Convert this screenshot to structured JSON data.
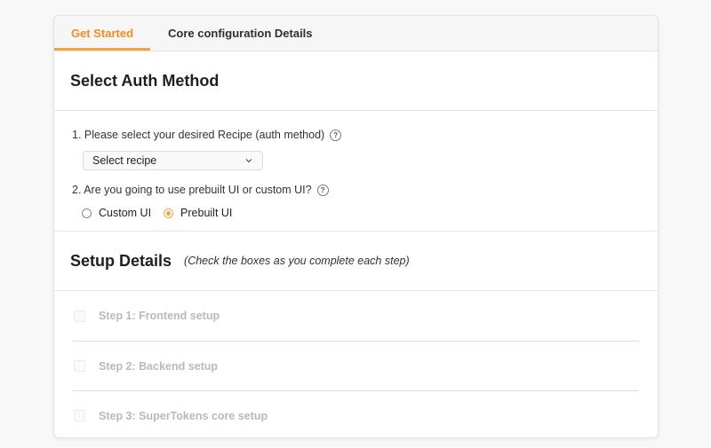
{
  "tabs": [
    {
      "label": "Get Started",
      "active": true
    },
    {
      "label": "Core configuration Details",
      "active": false
    }
  ],
  "auth": {
    "title": "Select Auth Method",
    "q1": "1. Please select your desired Recipe (auth method)",
    "select_value": "Select recipe",
    "q2": "2. Are you going to use prebuilt UI or custom UI?",
    "options": [
      {
        "label": "Custom UI",
        "selected": false
      },
      {
        "label": "Prebuilt UI",
        "selected": true
      }
    ]
  },
  "setup": {
    "title": "Setup Details",
    "note": "(Check the boxes as you complete each step)",
    "steps": [
      {
        "label": "Step 1: Frontend setup",
        "checked": false
      },
      {
        "label": "Step 2: Backend setup",
        "checked": false
      },
      {
        "label": "Step 3: SuperTokens core setup",
        "checked": false
      }
    ]
  },
  "colors": {
    "accent": "#f0a448",
    "accent_text": "#ec8d22",
    "disabled_text": "#b9b9b9"
  },
  "icons": {
    "help": "help-circle-icon",
    "chevron": "chevron-down-icon"
  }
}
